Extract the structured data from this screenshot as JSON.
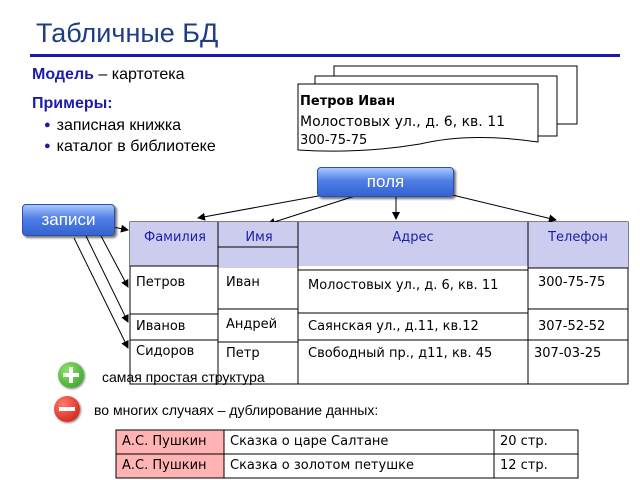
{
  "title": "Табличные БД",
  "model": {
    "label": "Модель",
    "text": " – картотека"
  },
  "examples": {
    "heading": "Примеры:",
    "items": [
      "записная книжка",
      "каталог в библиотеке"
    ]
  },
  "card": {
    "lines": [
      "Петров Иван",
      "Молостовых ул., д. 6, кв. 11",
      "300-75-75"
    ]
  },
  "fields_label": "поля",
  "records_label": "записи",
  "table": {
    "headers": [
      "Фамилия",
      "Имя",
      "Адрес",
      "Телефон"
    ],
    "rows": [
      [
        "Петров",
        "Иван",
        "Молостовых ул., д. 6, кв. 11",
        "300-75-75"
      ],
      [
        "Иванов",
        "Андрей",
        "Саянская ул., д.11, кв.12",
        "307-52-52"
      ],
      [
        "Сидоров",
        "Петр",
        "Свободный пр., д11, кв. 45",
        "307-03-25"
      ]
    ]
  },
  "plus_text": "самая простая структура",
  "minus_text": "во многих случаях – дублирование данных:",
  "books": {
    "rows": [
      [
        "А.С. Пушкин",
        "Сказка о царе Салтане",
        "20 стр."
      ],
      [
        "А.С. Пушкин",
        "Сказка о золотом петушке",
        "12 стр."
      ]
    ]
  },
  "colors": {
    "accent": "#1c1ca8",
    "header_cell": "#ccccee",
    "author_cell": "#ffb3b3",
    "pill": "#4f7fe5"
  }
}
